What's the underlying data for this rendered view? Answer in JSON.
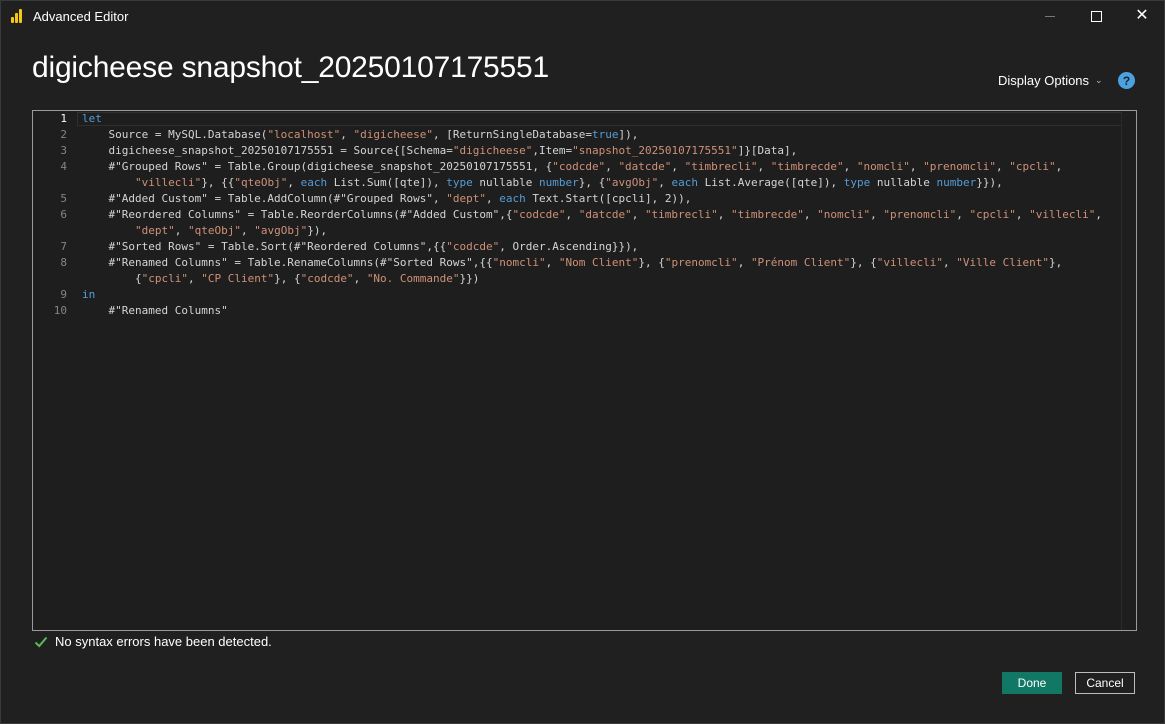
{
  "window": {
    "title": "Advanced Editor",
    "minimize_icon": "minimize-icon",
    "maximize_icon": "maximize-icon",
    "close_icon": "close-icon",
    "close_glyph": "✕"
  },
  "header": {
    "query_name": "digicheese snapshot_20250107175551",
    "display_options_label": "Display Options",
    "display_options_chevron": "⌄",
    "help_glyph": "?"
  },
  "editor": {
    "line_numbers": [
      "1",
      "2",
      "3",
      "4",
      "5",
      "6",
      "7",
      "8",
      "9",
      "10"
    ],
    "lines": [
      [
        {
          "t": "let",
          "c": "kw"
        }
      ],
      [
        {
          "t": "    Source = MySQL.Database(",
          "c": ""
        },
        {
          "t": "\"localhost\"",
          "c": "str"
        },
        {
          "t": ", ",
          "c": ""
        },
        {
          "t": "\"digicheese\"",
          "c": "str"
        },
        {
          "t": ", [ReturnSingleDatabase=",
          "c": ""
        },
        {
          "t": "true",
          "c": "kw"
        },
        {
          "t": "]),",
          "c": ""
        }
      ],
      [
        {
          "t": "    digicheese_snapshot_20250107175551 = Source{[Schema=",
          "c": ""
        },
        {
          "t": "\"digicheese\"",
          "c": "str"
        },
        {
          "t": ",Item=",
          "c": ""
        },
        {
          "t": "\"snapshot_20250107175551\"",
          "c": "str"
        },
        {
          "t": "]}[Data],",
          "c": ""
        }
      ],
      [
        {
          "t": "    #\"Grouped Rows\" = Table.Group(digicheese_snapshot_20250107175551, {",
          "c": ""
        },
        {
          "t": "\"codcde\"",
          "c": "str"
        },
        {
          "t": ", ",
          "c": ""
        },
        {
          "t": "\"datcde\"",
          "c": "str"
        },
        {
          "t": ", ",
          "c": ""
        },
        {
          "t": "\"timbrecli\"",
          "c": "str"
        },
        {
          "t": ", ",
          "c": ""
        },
        {
          "t": "\"timbrecde\"",
          "c": "str"
        },
        {
          "t": ", ",
          "c": ""
        },
        {
          "t": "\"nomcli\"",
          "c": "str"
        },
        {
          "t": ", ",
          "c": ""
        },
        {
          "t": "\"prenomcli\"",
          "c": "str"
        },
        {
          "t": ", ",
          "c": ""
        },
        {
          "t": "\"cpcli\"",
          "c": "str"
        },
        {
          "t": ",",
          "c": ""
        }
      ],
      [
        {
          "t": "        ",
          "c": ""
        },
        {
          "t": "\"villecli\"",
          "c": "str"
        },
        {
          "t": "}, {{",
          "c": ""
        },
        {
          "t": "\"qteObj\"",
          "c": "str"
        },
        {
          "t": ", ",
          "c": ""
        },
        {
          "t": "each",
          "c": "kw"
        },
        {
          "t": " List.Sum([qte]), ",
          "c": ""
        },
        {
          "t": "type",
          "c": "kw"
        },
        {
          "t": " nullable ",
          "c": ""
        },
        {
          "t": "number",
          "c": "kw"
        },
        {
          "t": "}, {",
          "c": ""
        },
        {
          "t": "\"avgObj\"",
          "c": "str"
        },
        {
          "t": ", ",
          "c": ""
        },
        {
          "t": "each",
          "c": "kw"
        },
        {
          "t": " List.Average([qte]), ",
          "c": ""
        },
        {
          "t": "type",
          "c": "kw"
        },
        {
          "t": " nullable ",
          "c": ""
        },
        {
          "t": "number",
          "c": "kw"
        },
        {
          "t": "}}),",
          "c": ""
        }
      ],
      [
        {
          "t": "    #\"Added Custom\" = Table.AddColumn(#\"Grouped Rows\", ",
          "c": ""
        },
        {
          "t": "\"dept\"",
          "c": "str"
        },
        {
          "t": ", ",
          "c": ""
        },
        {
          "t": "each",
          "c": "kw"
        },
        {
          "t": " Text.Start([cpcli], 2)),",
          "c": ""
        }
      ],
      [
        {
          "t": "    #\"Reordered Columns\" = Table.ReorderColumns(#\"Added Custom\",{",
          "c": ""
        },
        {
          "t": "\"codcde\"",
          "c": "str"
        },
        {
          "t": ", ",
          "c": ""
        },
        {
          "t": "\"datcde\"",
          "c": "str"
        },
        {
          "t": ", ",
          "c": ""
        },
        {
          "t": "\"timbrecli\"",
          "c": "str"
        },
        {
          "t": ", ",
          "c": ""
        },
        {
          "t": "\"timbrecde\"",
          "c": "str"
        },
        {
          "t": ", ",
          "c": ""
        },
        {
          "t": "\"nomcli\"",
          "c": "str"
        },
        {
          "t": ", ",
          "c": ""
        },
        {
          "t": "\"prenomcli\"",
          "c": "str"
        },
        {
          "t": ", ",
          "c": ""
        },
        {
          "t": "\"cpcli\"",
          "c": "str"
        },
        {
          "t": ", ",
          "c": ""
        },
        {
          "t": "\"villecli\"",
          "c": "str"
        },
        {
          "t": ",",
          "c": ""
        }
      ],
      [
        {
          "t": "        ",
          "c": ""
        },
        {
          "t": "\"dept\"",
          "c": "str"
        },
        {
          "t": ", ",
          "c": ""
        },
        {
          "t": "\"qteObj\"",
          "c": "str"
        },
        {
          "t": ", ",
          "c": ""
        },
        {
          "t": "\"avgObj\"",
          "c": "str"
        },
        {
          "t": "}),",
          "c": ""
        }
      ],
      [
        {
          "t": "    #\"Sorted Rows\" = Table.Sort(#\"Reordered Columns\",{{",
          "c": ""
        },
        {
          "t": "\"codcde\"",
          "c": "str"
        },
        {
          "t": ", Order.Ascending}}),",
          "c": ""
        }
      ],
      [
        {
          "t": "    #\"Renamed Columns\" = Table.RenameColumns(#\"Sorted Rows\",{{",
          "c": ""
        },
        {
          "t": "\"nomcli\"",
          "c": "str"
        },
        {
          "t": ", ",
          "c": ""
        },
        {
          "t": "\"Nom Client\"",
          "c": "str"
        },
        {
          "t": "}, {",
          "c": ""
        },
        {
          "t": "\"prenomcli\"",
          "c": "str"
        },
        {
          "t": ", ",
          "c": ""
        },
        {
          "t": "\"Prénom Client\"",
          "c": "str"
        },
        {
          "t": "}, {",
          "c": ""
        },
        {
          "t": "\"villecli\"",
          "c": "str"
        },
        {
          "t": ", ",
          "c": ""
        },
        {
          "t": "\"Ville Client\"",
          "c": "str"
        },
        {
          "t": "},",
          "c": ""
        }
      ],
      [
        {
          "t": "        {",
          "c": ""
        },
        {
          "t": "\"cpcli\"",
          "c": "str"
        },
        {
          "t": ", ",
          "c": ""
        },
        {
          "t": "\"CP Client\"",
          "c": "str"
        },
        {
          "t": "}, {",
          "c": ""
        },
        {
          "t": "\"codcde\"",
          "c": "str"
        },
        {
          "t": ", ",
          "c": ""
        },
        {
          "t": "\"No. Commande\"",
          "c": "str"
        },
        {
          "t": "}})",
          "c": ""
        }
      ],
      [
        {
          "t": "in",
          "c": "kw"
        }
      ],
      [
        {
          "t": "    #\"Renamed Columns\"",
          "c": ""
        }
      ]
    ]
  },
  "status": {
    "icon": "checkmark-icon",
    "message": "No syntax errors have been detected.",
    "color": "#5cb85c"
  },
  "footer": {
    "done_label": "Done",
    "cancel_label": "Cancel",
    "done_color": "#117865"
  }
}
